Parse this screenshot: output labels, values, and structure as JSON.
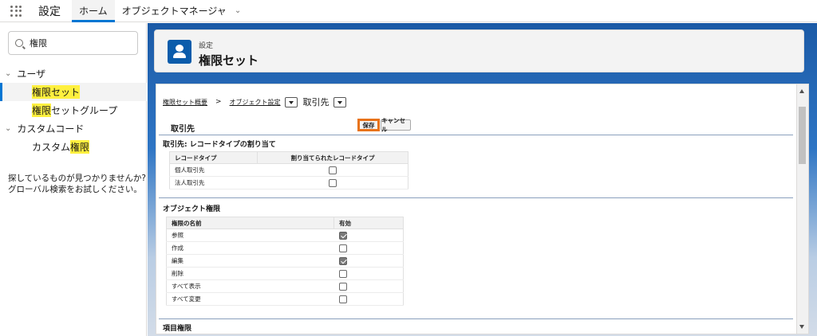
{
  "app": {
    "name": "設定"
  },
  "nav": {
    "tabs": [
      {
        "label": "ホーム"
      },
      {
        "label": "オブジェクトマネージャ"
      }
    ]
  },
  "sidebar": {
    "search_value": "権限",
    "groups": [
      {
        "label": "ユーザ"
      },
      {
        "label": "カスタムコード"
      }
    ],
    "items": [
      {
        "label": "権限セット"
      },
      {
        "pre": "",
        "hl": "権限",
        "post": "セットグループ"
      },
      {
        "pre": "カスタム",
        "hl": "権限",
        "post": ""
      }
    ],
    "help_line1": "探しているものが見つかりませんか?",
    "help_line2": "グローバル検索をお試しください。"
  },
  "header": {
    "supertitle": "設定",
    "title": "権限セット"
  },
  "breadcrumb": {
    "item1": "権限セット概要",
    "separator": ">",
    "item2": "オブジェクト設定",
    "current": "取引先"
  },
  "object_section": {
    "title": "取引先",
    "save_label": "保存",
    "cancel_label": "キャンセル"
  },
  "record_types": {
    "title": "取引先: レコードタイプの割り当て",
    "columns": [
      "レコードタイプ",
      "割り当てられたレコードタイプ"
    ],
    "rows": [
      {
        "name": "個人取引先",
        "checked": false
      },
      {
        "name": "法人取引先",
        "checked": false
      }
    ]
  },
  "object_permissions": {
    "title": "オブジェクト権限",
    "columns": [
      "権限の名前",
      "有効"
    ],
    "rows": [
      {
        "name": "参照",
        "checked": true
      },
      {
        "name": "作成",
        "checked": false
      },
      {
        "name": "編集",
        "checked": true
      },
      {
        "name": "削除",
        "checked": false
      },
      {
        "name": "すべて表示",
        "checked": false
      },
      {
        "name": "すべて変更",
        "checked": false
      }
    ]
  },
  "field_permissions": {
    "title": "項目権限"
  },
  "colors": {
    "brand": "#0176d3",
    "highlight": "#fff03f",
    "save_outline": "#e8731a"
  }
}
